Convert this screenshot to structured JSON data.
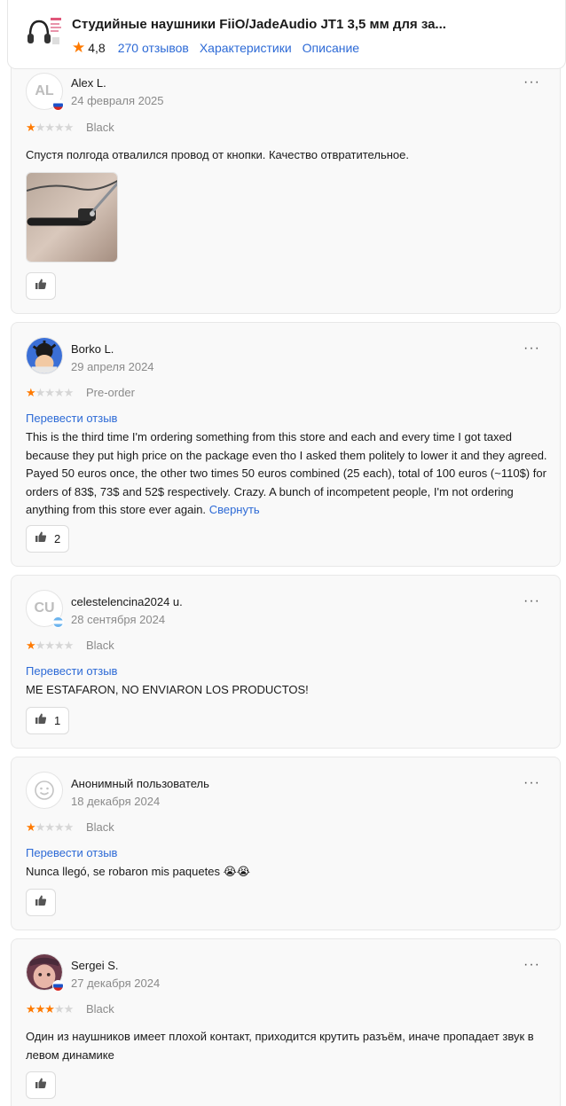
{
  "product": {
    "title": "Студийные наушники FiiO/JadeAudio JT1 3,5 мм для за...",
    "rating": "4,8",
    "reviews_link": "270 отзывов",
    "specs_link": "Характеристики",
    "description_link": "Описание"
  },
  "colors": {
    "accent_link": "#2d6ad6",
    "star_on": "#ff7a00",
    "star_off": "#d6d6d6"
  },
  "ui": {
    "more_label": "···",
    "translate_label": "Перевести отзыв",
    "collapse_label": "Свернуть"
  },
  "reviews": [
    {
      "initials": "AL",
      "flag": "ru",
      "name": "Alex L.",
      "date": "24 февраля 2025",
      "rating": 1,
      "variant": "Black",
      "text": "Спустя полгода отвалился провод от кнопки. Качество отвратительное.",
      "has_photo": true,
      "likes": ""
    },
    {
      "initials": "",
      "flag": "",
      "name": "Borko L.",
      "date": "29 апреля 2024",
      "rating": 1,
      "variant": "Pre-order",
      "translate": true,
      "text": "This is the third time I'm ordering something from this store and each and every time I got taxed because they put high price on the package even tho I asked them politely to lower it and they agreed. Payed 50 euros once, the other two times 50 euros combined (25 each), total of 100 euros (~110$) for orders of 83$, 73$ and 52$ respectively. Crazy.  A bunch of incompetent people, I'm not ordering anything from this store ever again.",
      "likes": "2"
    },
    {
      "initials": "CU",
      "flag": "ar",
      "name": "celestelencina2024 u.",
      "date": "28 сентября 2024",
      "rating": 1,
      "variant": "Black",
      "translate": true,
      "text": "ME ESTAFARON, NO ENVIARON LOS PRODUCTOS!",
      "likes": "1"
    },
    {
      "initials": "",
      "flag": "",
      "name": "Анонимный пользователь",
      "date": "18 декабря 2024",
      "rating": 1,
      "variant": "Black",
      "translate": true,
      "text": "Nunca llegó, se robaron mis paquetes 😭😭",
      "likes": ""
    },
    {
      "initials": "",
      "flag": "ru",
      "name": "Sergei S.",
      "date": "27 декабря 2024",
      "rating": 3,
      "variant": "Black",
      "text": "Один из наушников имеет плохой контакт, приходится крутить разъём, иначе пропадает звук в левом динамике",
      "likes": ""
    }
  ]
}
